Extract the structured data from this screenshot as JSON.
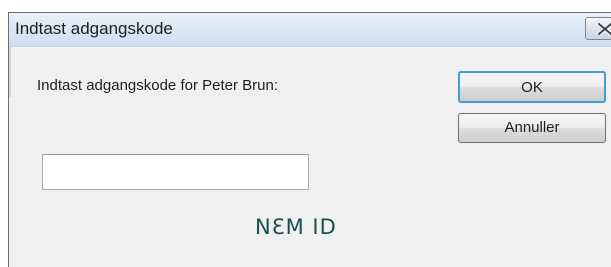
{
  "window": {
    "title": "Indtast adgangskode",
    "close_icon": "close-icon"
  },
  "form": {
    "prompt": "Indtast adgangskode for Peter Brun:",
    "password_value": ""
  },
  "buttons": {
    "ok_label": "OK",
    "cancel_label": "Annuller"
  },
  "logo": {
    "text": "NƐM ID",
    "color": "#1a4f4b"
  }
}
